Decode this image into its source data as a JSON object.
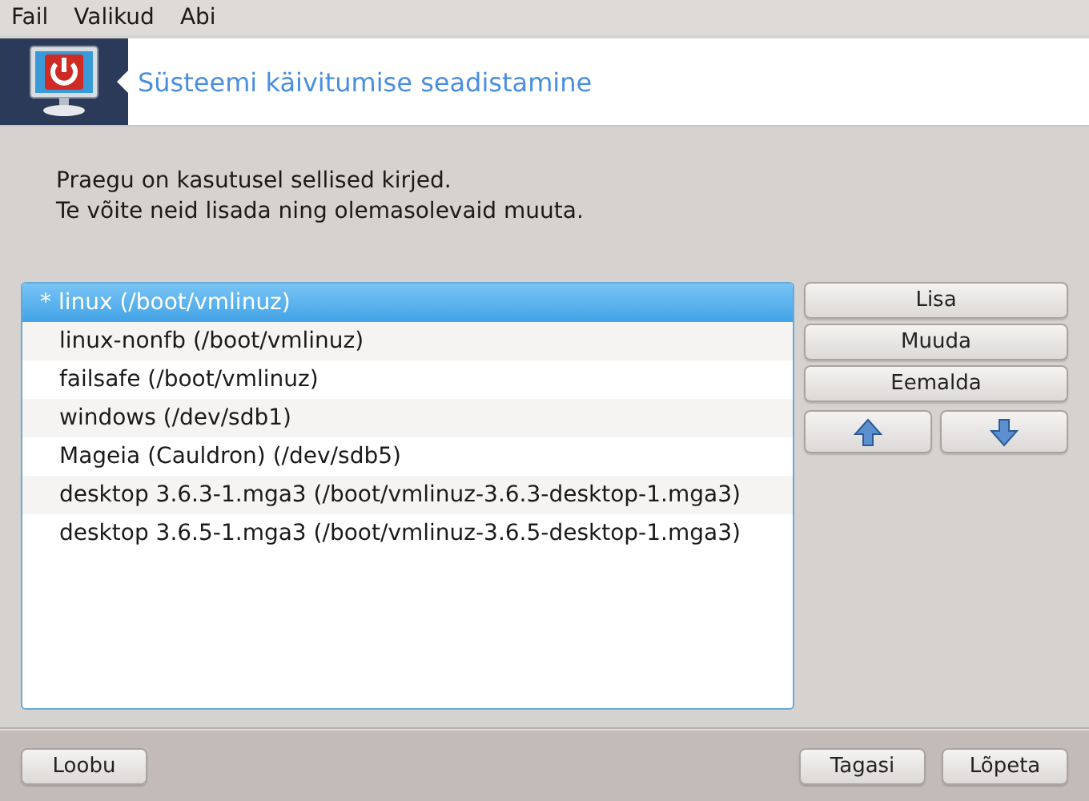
{
  "menu": [
    {
      "label": "Fail"
    },
    {
      "label": "Valikud"
    },
    {
      "label": "Abi"
    }
  ],
  "header": {
    "title": "Süsteemi käivitumise seadistamine"
  },
  "intro": [
    "Praegu on kasutusel sellised kirjed.",
    "Te võite neid lisada ning olemasolevaid muuta."
  ],
  "entries": [
    {
      "label": "*  linux (/boot/vmlinuz)",
      "selected": true
    },
    {
      "label": "linux-nonfb (/boot/vmlinuz)",
      "selected": false
    },
    {
      "label": "failsafe (/boot/vmlinuz)",
      "selected": false
    },
    {
      "label": "windows (/dev/sdb1)",
      "selected": false
    },
    {
      "label": "Mageia (Cauldron) (/dev/sdb5)",
      "selected": false
    },
    {
      "label": "desktop 3.6.3-1.mga3 (/boot/vmlinuz-3.6.3-desktop-1.mga3)",
      "selected": false
    },
    {
      "label": "desktop 3.6.5-1.mga3 (/boot/vmlinuz-3.6.5-desktop-1.mga3)",
      "selected": false
    }
  ],
  "side_buttons": [
    "Lisa",
    "Muuda",
    "Eemalda"
  ],
  "move_buttons": [
    {
      "kind": "up"
    },
    {
      "kind": "down"
    }
  ],
  "footer": {
    "left": [
      "Loobu"
    ],
    "right": [
      "Tagasi",
      "Lõpeta"
    ]
  }
}
